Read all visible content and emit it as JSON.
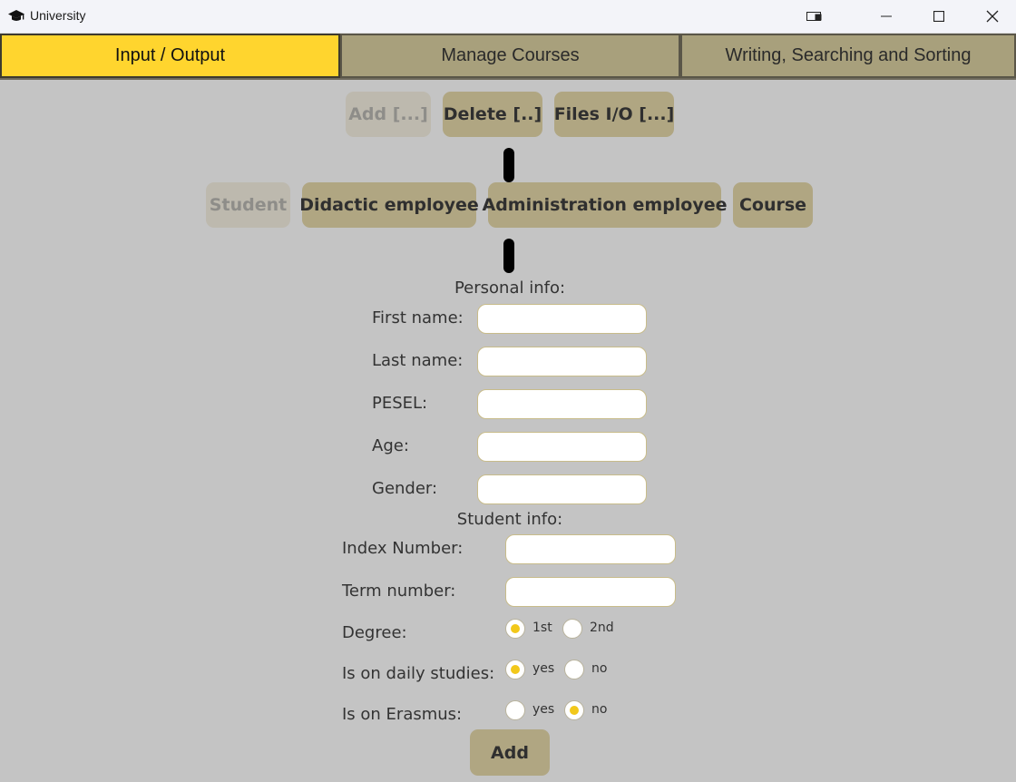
{
  "window": {
    "title": "University",
    "icon": "graduation-cap-icon"
  },
  "tabs": [
    {
      "label": "Input / Output",
      "active": true
    },
    {
      "label": "Manage Courses",
      "active": false
    },
    {
      "label": "Writing, Searching and Sorting",
      "active": false
    }
  ],
  "actions": [
    {
      "label": "Add [...]",
      "disabled": true
    },
    {
      "label": "Delete [..]",
      "disabled": false
    },
    {
      "label": "Files I/O [...]",
      "disabled": false
    }
  ],
  "entities": [
    {
      "label": "Student",
      "disabled": true
    },
    {
      "label": "Didactic employee",
      "disabled": false
    },
    {
      "label": "Administration employee",
      "disabled": false
    },
    {
      "label": "Course",
      "disabled": false
    }
  ],
  "personal": {
    "heading": "Personal info:",
    "fields": [
      {
        "label": "First name:",
        "value": ""
      },
      {
        "label": "Last name:",
        "value": ""
      },
      {
        "label": "PESEL:",
        "value": ""
      },
      {
        "label": "Age:",
        "value": ""
      },
      {
        "label": "Gender:",
        "value": ""
      }
    ]
  },
  "student": {
    "heading": "Student info:",
    "fields": [
      {
        "label": "Index Number:",
        "value": ""
      },
      {
        "label": "Term number:",
        "value": ""
      }
    ],
    "radios": [
      {
        "label": "Degree:",
        "options": [
          "1st",
          "2nd"
        ],
        "selected": "1st"
      },
      {
        "label": "Is on daily studies:",
        "options": [
          "yes",
          "no"
        ],
        "selected": "yes"
      },
      {
        "label": "Is on Erasmus:",
        "options": [
          "yes",
          "no"
        ],
        "selected": "no"
      }
    ]
  },
  "submit_label": "Add",
  "colors": {
    "accent": "#ffd52e",
    "tab": "#a8a07c",
    "pill": "#b0a682",
    "background": "#c4c4c4"
  }
}
